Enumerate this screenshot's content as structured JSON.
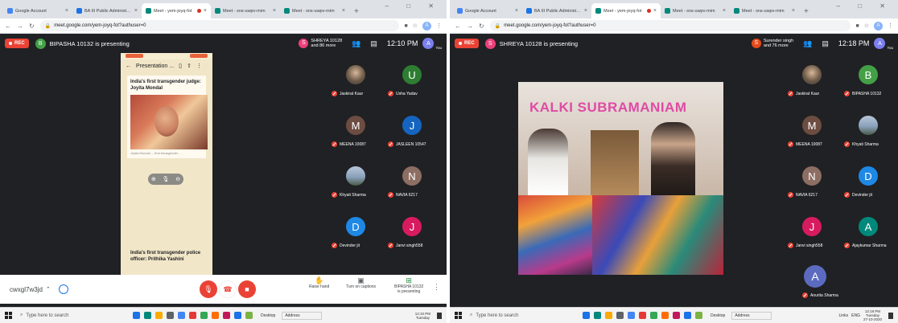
{
  "left": {
    "tabs": [
      {
        "label": "Google Account",
        "color": "#4285f4",
        "active": false
      },
      {
        "label": "BA III Public Administration (Lu...",
        "color": "#1a73e8",
        "active": false
      },
      {
        "label": "Meet - yem-joyq-fot",
        "color": "#00897b",
        "active": true,
        "recording": true
      },
      {
        "label": "Meet - sns-uwpv-mim",
        "color": "#00897b",
        "active": false
      },
      {
        "label": "Meet - sns-uwpv-mim",
        "color": "#00897b",
        "active": false
      }
    ],
    "url": "meet.google.com/yem-joyq-fot?authuser=0",
    "rec_label": "REC",
    "presenter": {
      "initial": "B",
      "color": "#43a047",
      "text": "BIPASHA 10132 is presenting"
    },
    "participants_chip": {
      "initial": "S",
      "color": "#ec407a",
      "line1": "SHREYA 10128",
      "line2": "and 86 more"
    },
    "clock": "12:10 PM",
    "you_initial": "A",
    "you_label": "You",
    "phone": {
      "header": "Presentation ...",
      "card1_title": "India's first transgender judge: Joyita Mondal",
      "card1_caption": "Joyita Mondal ... first transgender ...",
      "card2_title": "India's first transgender police officer: Prithika Yashini"
    },
    "grid": [
      {
        "name": "Jaskirat Kaur",
        "initial": "",
        "style": "photo",
        "color": ""
      },
      {
        "name": "Usha Yadav",
        "initial": "U",
        "style": "letter",
        "color": "#2e7d32"
      },
      {
        "name": "MEENA 10087",
        "initial": "M",
        "style": "letter",
        "color": "#6d4c41"
      },
      {
        "name": "JASLEEN 10547",
        "initial": "J",
        "style": "letter",
        "color": "#1565c0"
      },
      {
        "name": "Khyati Sharma",
        "initial": "",
        "style": "sky",
        "color": ""
      },
      {
        "name": "NAVIA 6217",
        "initial": "N",
        "style": "letter",
        "color": "#8d6e63"
      },
      {
        "name": "Devinder jit",
        "initial": "D",
        "style": "letter",
        "color": "#1e88e5"
      },
      {
        "name": "Janvi singh558",
        "initial": "J",
        "style": "letter",
        "color": "#d81b60"
      }
    ],
    "bottom": {
      "meeting_code": "cwxgl7w3jd",
      "raise_hand": "Raise hand",
      "captions": "Turn on captions",
      "presenting_line1": "BIPASHA 10132",
      "presenting_line2": "is presenting"
    }
  },
  "right": {
    "tabs": [
      {
        "label": "Google Account",
        "color": "#4285f4",
        "active": false
      },
      {
        "label": "BA III Public Administration (Lu...",
        "color": "#1a73e8",
        "active": false
      },
      {
        "label": "Meet - yem-joyq-fot",
        "color": "#00897b",
        "active": true,
        "recording": true
      },
      {
        "label": "Meet - sns-uwpv-mim",
        "color": "#00897b",
        "active": false
      },
      {
        "label": "Meet - sns-uwpv-mim",
        "color": "#00897b",
        "active": false
      }
    ],
    "url": "meet.google.com/yem-joyq-fot?authuser=0",
    "rec_label": "REC",
    "presenter": {
      "initial": "S",
      "color": "#ec407a",
      "text": "SHREYA 10128 is presenting"
    },
    "participants_chip": {
      "initial": "S",
      "color": "#e64a19",
      "line1": "Surender singh",
      "line2": "and 76 more"
    },
    "clock": "12:18 PM",
    "you_initial": "A",
    "you_label": "You",
    "slide_title": "KALKI SUBRAMANIAM",
    "grid": [
      {
        "name": "Jaskirat Kaur",
        "initial": "",
        "style": "photo",
        "color": ""
      },
      {
        "name": "BIPASHA 10132",
        "initial": "B",
        "style": "letter",
        "color": "#43a047"
      },
      {
        "name": "MEENA 10087",
        "initial": "M",
        "style": "letter",
        "color": "#6d4c41"
      },
      {
        "name": "Khyati Sharma",
        "initial": "",
        "style": "sky",
        "color": ""
      },
      {
        "name": "NAVIA 6217",
        "initial": "N",
        "style": "letter",
        "color": "#8d6e63"
      },
      {
        "name": "Devinder jit",
        "initial": "D",
        "style": "letter",
        "color": "#1e88e5"
      },
      {
        "name": "Janvi singh558",
        "initial": "J",
        "style": "letter",
        "color": "#d81b60"
      },
      {
        "name": "Ajaykumar Sharma",
        "initial": "A",
        "style": "letter",
        "color": "#00897b"
      }
    ],
    "extra_tile": {
      "name": "Anurita Sharma",
      "initial": "A",
      "color": "#5c6bc0"
    }
  },
  "taskbar_left": {
    "search_placeholder": "Type here to search",
    "desktop": "Desktop",
    "address": "Address",
    "clock_time": "12:10 PM",
    "clock_date": "Tuesday"
  },
  "taskbar_right": {
    "search_placeholder": "Type here to search",
    "desktop": "Desktop",
    "address": "Address",
    "lang": "ENG",
    "links": "Links",
    "clock_time": "12:18 PM",
    "clock_date": "Tuesday",
    "clock_full": "27-10-2020"
  },
  "app_icon_colors": [
    "#1a73e8",
    "#00897b",
    "#f9ab00",
    "#5f6368",
    "#4285f4",
    "#e53935",
    "#34a853",
    "#ff6d00",
    "#c2185b",
    "#1a73e8",
    "#7cb342"
  ]
}
